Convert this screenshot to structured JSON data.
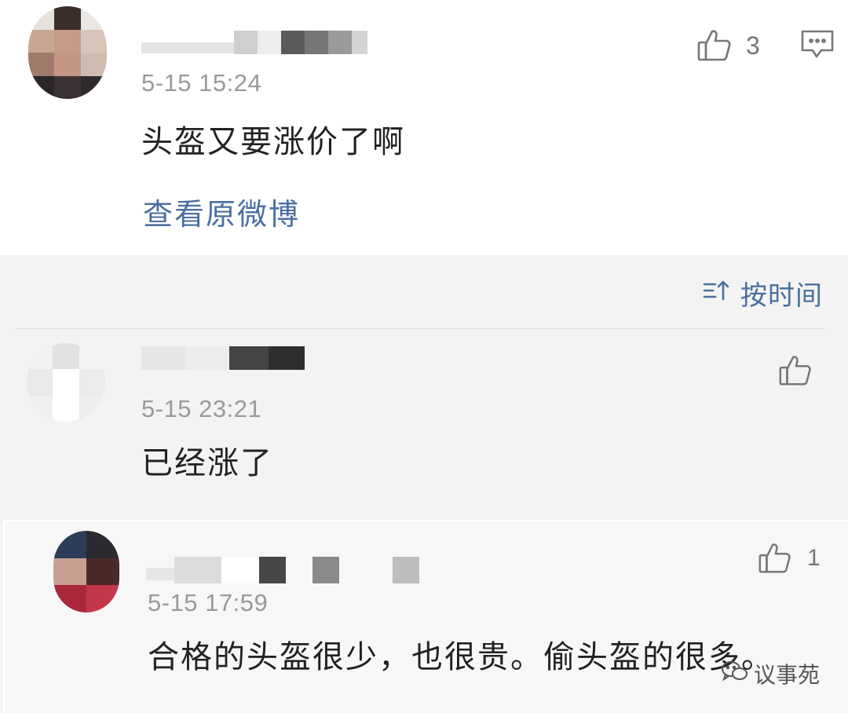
{
  "main_comment": {
    "time": "5-15 15:24",
    "text": "头盔又要涨价了啊",
    "view_original_label": "查看原微博",
    "like_count": "3",
    "icons": {
      "like": "thumbs-up-icon",
      "reply": "comment-bubble-icon"
    }
  },
  "replies_section": {
    "sort_label": "按时间",
    "sort_icon": "sort-ascending-icon",
    "replies": [
      {
        "time": "5-15 23:21",
        "text": "已经涨了",
        "like_count": ""
      },
      {
        "time": "5-15 17:59",
        "text": "合格的头盔很少，也很贵。偷头盔的很多。",
        "like_count": "1"
      }
    ]
  },
  "watermark": {
    "text": "议事苑",
    "icon": "wechat-icon"
  },
  "colors": {
    "link_blue": "#4a6fa0",
    "text_dark": "#222222",
    "text_gray": "#9a9a9a",
    "replies_bg": "#f3f3f3"
  }
}
